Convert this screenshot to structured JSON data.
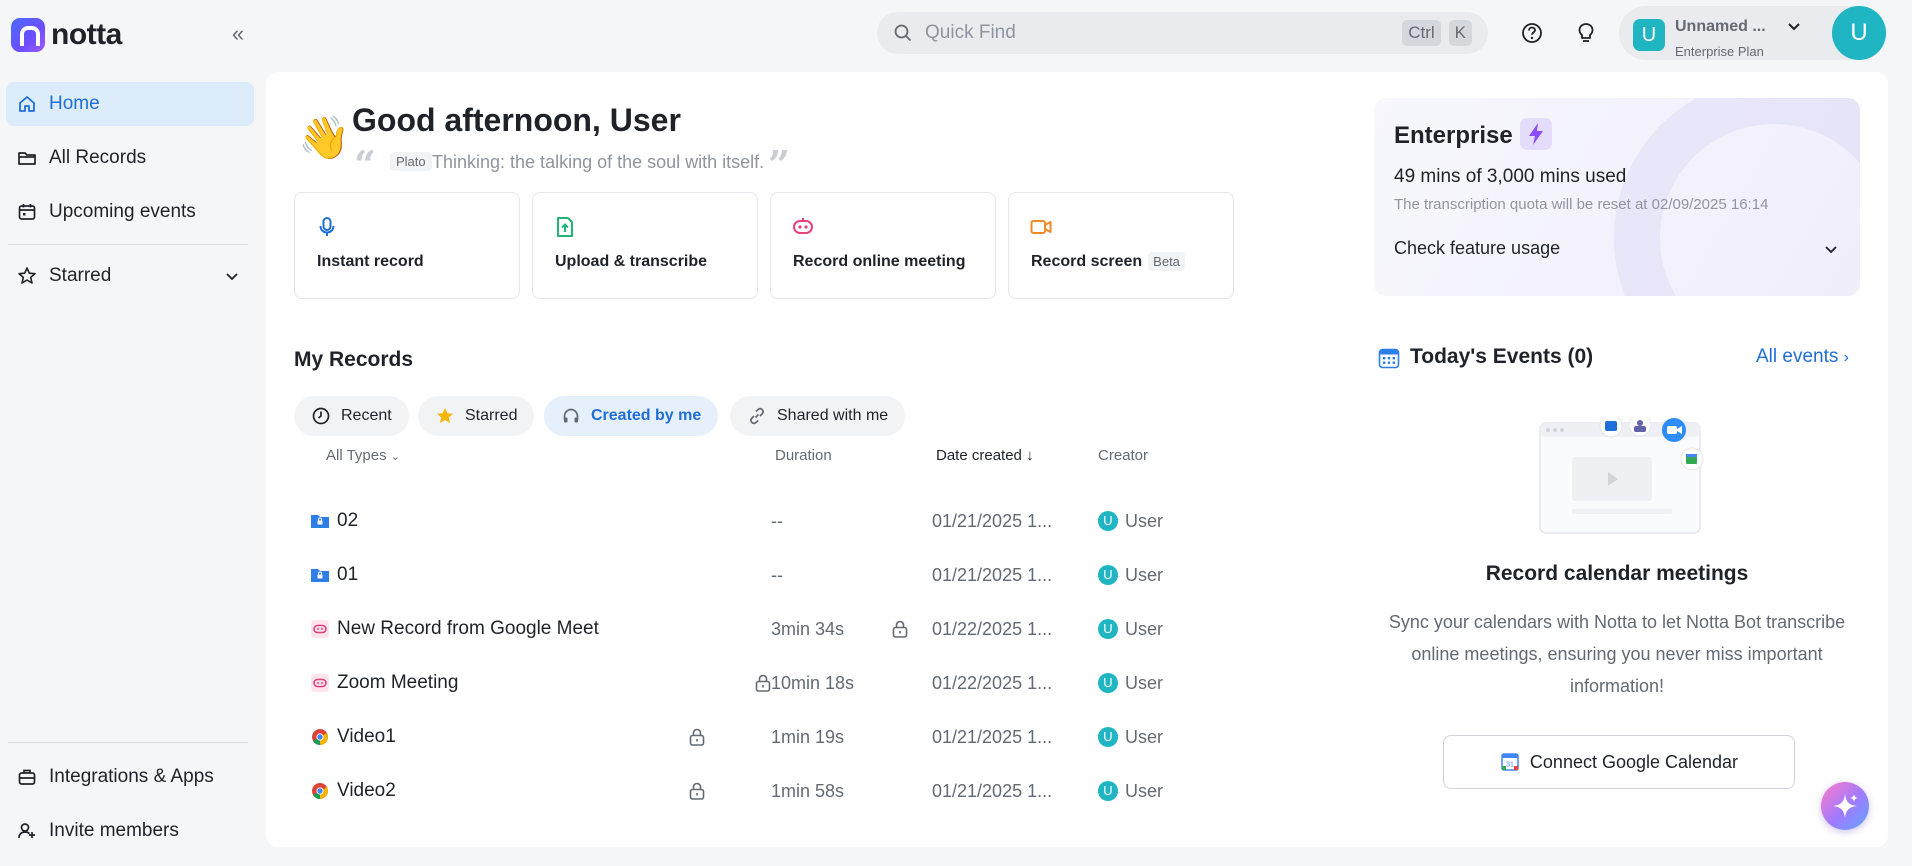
{
  "brand": {
    "name": "notta"
  },
  "sidebar": {
    "items": [
      {
        "label": "Home"
      },
      {
        "label": "All Records"
      },
      {
        "label": "Upcoming events"
      },
      {
        "label": "Starred"
      }
    ],
    "bottom_items": [
      {
        "label": "Integrations & Apps"
      },
      {
        "label": "Invite members"
      }
    ]
  },
  "header": {
    "search_placeholder": "Quick Find",
    "shortcut_key1": "Ctrl",
    "shortcut_key2": "K",
    "account_initial": "U",
    "account_name": "Unnamed ...",
    "account_plan": "Enterprise Plan",
    "user_initial": "U"
  },
  "greeting": {
    "title": "Good afternoon, User",
    "quote_author": "Plato",
    "quote_text": "Thinking: the talking of the soul with itself."
  },
  "actions": [
    {
      "label": "Instant record"
    },
    {
      "label": "Upload & transcribe"
    },
    {
      "label": "Record online meeting"
    },
    {
      "label": "Record screen",
      "badge": "Beta"
    }
  ],
  "records": {
    "title": "My Records",
    "tabs": [
      {
        "label": "Recent"
      },
      {
        "label": "Starred"
      },
      {
        "label": "Created by me"
      },
      {
        "label": "Shared with me"
      }
    ],
    "columns": {
      "type": "All Types",
      "duration": "Duration",
      "date": "Date created",
      "creator": "Creator"
    },
    "rows": [
      {
        "name": "02",
        "duration": "--",
        "date": "01/21/2025 1...",
        "creator_initial": "U",
        "creator": "User"
      },
      {
        "name": "01",
        "duration": "--",
        "date": "01/21/2025 1...",
        "creator_initial": "U",
        "creator": "User"
      },
      {
        "name": "New Record from Google Meet",
        "duration": "3min 34s",
        "date": "01/22/2025 1...",
        "creator_initial": "U",
        "creator": "User"
      },
      {
        "name": "Zoom Meeting",
        "duration": "10min 18s",
        "date": "01/22/2025 1...",
        "creator_initial": "U",
        "creator": "User"
      },
      {
        "name": "Video1",
        "duration": "1min 19s",
        "date": "01/21/2025 1...",
        "creator_initial": "U",
        "creator": "User"
      },
      {
        "name": "Video2",
        "duration": "1min 58s",
        "date": "01/21/2025 1...",
        "creator_initial": "U",
        "creator": "User"
      }
    ]
  },
  "plan": {
    "title": "Enterprise",
    "usage": "49 mins of 3,000 mins used",
    "reset_note": "The transcription quota will be reset at 02/09/2025 16:14",
    "check_label": "Check feature usage"
  },
  "events": {
    "title": "Today's Events (0)",
    "all_link": "All events",
    "empty_title": "Record calendar meetings",
    "empty_desc": "Sync your calendars with Notta to let Notta Bot transcribe online meetings, ensuring you never miss important information!",
    "connect_google": "Connect Google Calendar"
  },
  "colors": {
    "accent": "#1f6fd6",
    "active_bg": "#dcecfb",
    "teal_avatar": "#1fb5c2"
  }
}
